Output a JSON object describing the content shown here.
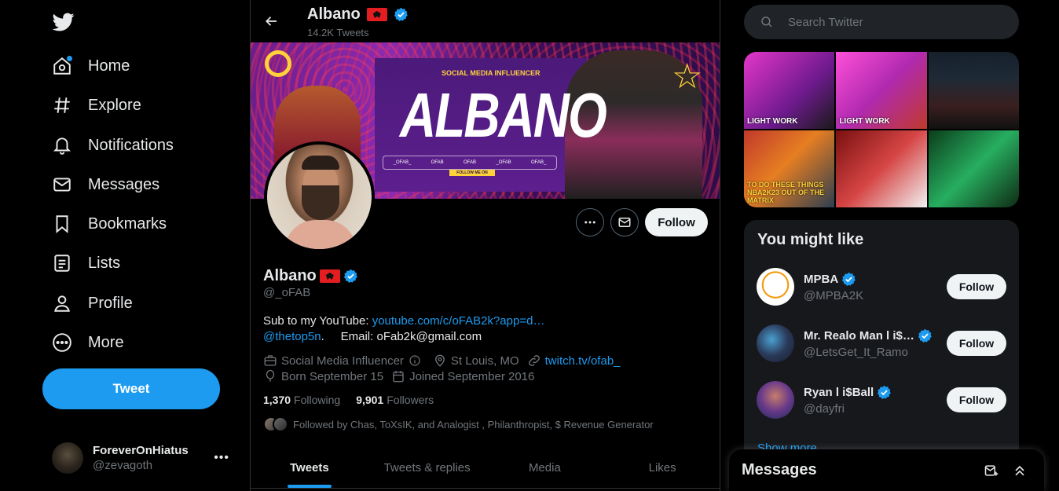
{
  "nav": {
    "items": [
      {
        "label": "Home"
      },
      {
        "label": "Explore"
      },
      {
        "label": "Notifications"
      },
      {
        "label": "Messages"
      },
      {
        "label": "Bookmarks"
      },
      {
        "label": "Lists"
      },
      {
        "label": "Profile"
      },
      {
        "label": "More"
      }
    ],
    "tweet_label": "Tweet",
    "account": {
      "name": "ForeverOnHiatus",
      "handle": "@zevagoth"
    }
  },
  "header": {
    "name": "Albano",
    "tweet_count": "14.2K Tweets"
  },
  "banner": {
    "title": "ALBANO",
    "tagline": "SOCIAL MEDIA INFLUENCER",
    "socials": [
      "_OFAB_",
      "OFAB",
      "OFAB",
      "_OFAB",
      "OFAB_"
    ],
    "follow_me": "FOLLOW ME ON"
  },
  "profile": {
    "name": "Albano",
    "handle": "@_oFAB",
    "follow_label": "Follow",
    "bio": {
      "prefix": "Sub to my YouTube: ",
      "link1": "youtube.com/c/oFAB2k?app=d…",
      "mention": "@thetop5n",
      "middle": ".     Email: ",
      "email": "oFab2k@gmail.com"
    },
    "category": "Social Media Influencer",
    "location": "St Louis, MO",
    "website": "twitch.tv/ofab_",
    "born": "Born September 15",
    "joined": "Joined September 2016",
    "following_count": "1,370",
    "following_label": "Following",
    "followers_count": "9,901",
    "followers_label": "Followers",
    "followed_by": "Followed by Chas, ToXsIK, and Analogist , Philanthropist, $ Revenue Generator"
  },
  "tabs": [
    {
      "label": "Tweets"
    },
    {
      "label": "Tweets & replies"
    },
    {
      "label": "Media"
    },
    {
      "label": "Likes"
    }
  ],
  "search": {
    "placeholder": "Search Twitter"
  },
  "media": {
    "captions": [
      "LIGHT WORK",
      "LIGHT WORK",
      "",
      "TO DO THESE THINGS NBA2K23 OUT OF THE MATRIX",
      "",
      ""
    ]
  },
  "who_to_follow": {
    "title": "You might like",
    "accounts": [
      {
        "name": "MPBA",
        "handle": "@MPBA2K",
        "follow": "Follow"
      },
      {
        "name": "Mr. Realo Man l i$…",
        "handle": "@LetsGet_It_Ramo",
        "follow": "Follow"
      },
      {
        "name": "Ryan l i$Ball",
        "handle": "@dayfri",
        "follow": "Follow"
      }
    ],
    "show_more": "Show more"
  },
  "messages_drawer": {
    "title": "Messages"
  },
  "colors": {
    "accent": "#1d9bf0",
    "background": "#000000",
    "muted": "#71767b"
  },
  "icons": [
    "twitter-logo-icon",
    "home-icon",
    "hashtag-icon",
    "bell-icon",
    "envelope-icon",
    "bookmark-icon",
    "list-icon",
    "person-icon",
    "more-circle-icon",
    "verified-badge-icon",
    "search-icon"
  ]
}
